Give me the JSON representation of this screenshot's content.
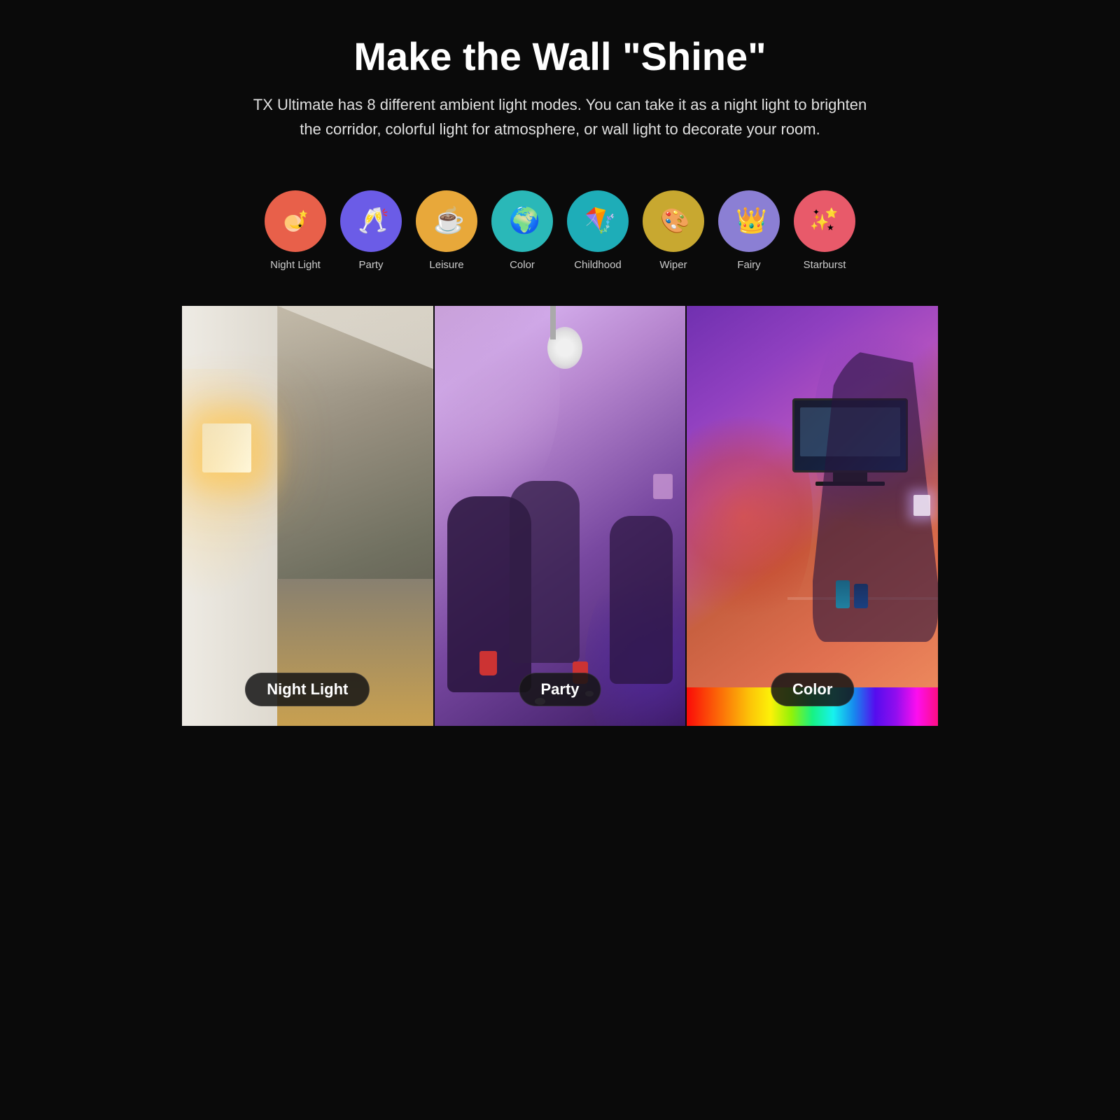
{
  "header": {
    "title": "Make the Wall \"Shine\"",
    "subtitle": "TX Ultimate has 8 different ambient light modes. You can take it as a night light to brighten the corridor, colorful light for atmosphere, or wall light to decorate your room."
  },
  "modes": [
    {
      "id": "night-light",
      "label": "Night Light",
      "icon": "🌙",
      "emoji": "🌙",
      "bg_class": "night-light"
    },
    {
      "id": "party",
      "label": "Party",
      "icon": "🥂",
      "emoji": "🥂",
      "bg_class": "party"
    },
    {
      "id": "leisure",
      "label": "Leisure",
      "icon": "☕",
      "emoji": "☕",
      "bg_class": "leisure"
    },
    {
      "id": "color",
      "label": "Color",
      "icon": "🌍",
      "emoji": "🌍",
      "bg_class": "color"
    },
    {
      "id": "childhood",
      "label": "Childhood",
      "icon": "🪁",
      "emoji": "🪁",
      "bg_class": "childhood"
    },
    {
      "id": "wiper",
      "label": "Wiper",
      "icon": "🎨",
      "emoji": "🎨",
      "bg_class": "wiper"
    },
    {
      "id": "fairy",
      "label": "Fairy",
      "icon": "👑",
      "emoji": "👑",
      "bg_class": "fairy"
    },
    {
      "id": "starburst",
      "label": "Starburst",
      "icon": "✨",
      "emoji": "✨",
      "bg_class": "starburst"
    }
  ],
  "photos": [
    {
      "id": "night-light-photo",
      "label": "Night Light",
      "scene": "night"
    },
    {
      "id": "party-photo",
      "label": "Party",
      "scene": "party"
    },
    {
      "id": "color-photo",
      "label": "Color",
      "scene": "color"
    }
  ]
}
